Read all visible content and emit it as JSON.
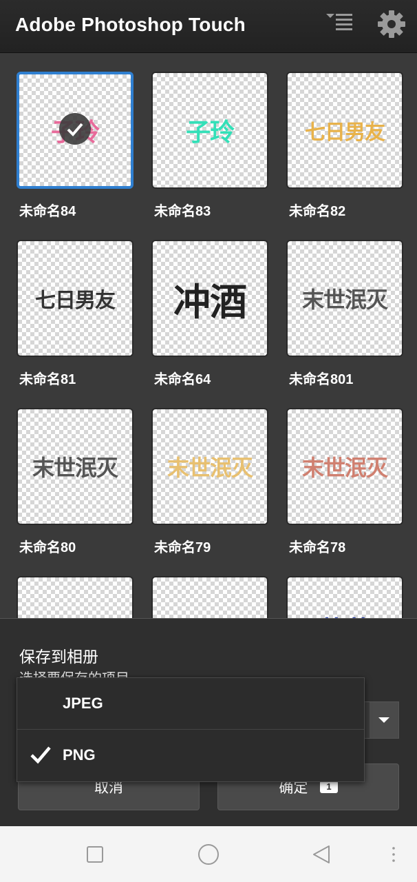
{
  "app": {
    "title": "Adobe Photoshop Touch"
  },
  "icons": {
    "sort": "sort-list-icon",
    "settings": "gear-icon",
    "check": "check-icon",
    "dropdown": "triangle-down-icon",
    "nav_recent": "square-icon",
    "nav_home": "circle-icon",
    "nav_back": "triangle-left-icon",
    "nav_more": "vertical-dots-icon"
  },
  "colors": {
    "selection": "#2f7fd0",
    "topbar": "#222222",
    "background": "#3a3a3a"
  },
  "projects": [
    {
      "name": "未命名84",
      "art_text": "子玲",
      "art_color": "#e86a9a",
      "selected": true
    },
    {
      "name": "未命名83",
      "art_text": "子玲",
      "art_color": "#33e0b8",
      "selected": false
    },
    {
      "name": "未命名82",
      "art_text": "七日男友",
      "art_color": "#e8b24a",
      "selected": false
    },
    {
      "name": "未命名81",
      "art_text": "七日男友",
      "art_color": "#333333",
      "selected": false
    },
    {
      "name": "未命名64",
      "art_text": "冲酒",
      "art_color": "#222222",
      "selected": false
    },
    {
      "name": "未命名801",
      "art_text": "末世泯灭",
      "art_color": "#555555",
      "selected": false
    },
    {
      "name": "未命名80",
      "art_text": "末世泯灭",
      "art_color": "#555555",
      "selected": false
    },
    {
      "name": "未命名79",
      "art_text": "末世泯灭",
      "art_color": "#e8c070",
      "selected": false
    },
    {
      "name": "未命名78",
      "art_text": "末世泯灭",
      "art_color": "#d08070",
      "selected": false
    },
    {
      "name": "",
      "art_text": "",
      "art_color": "#999999",
      "selected": false
    },
    {
      "name": "",
      "art_text": "",
      "art_color": "#c8a080",
      "selected": false
    },
    {
      "name": "",
      "art_text": "落花",
      "art_color": "#2a3fa0",
      "selected": false
    }
  ],
  "dialog": {
    "title": "保存到相册",
    "subtitle": "选择要保存的项目",
    "cancel_label": "取消",
    "ok_label": "确定",
    "selected_count": "1"
  },
  "format_menu": {
    "options": [
      {
        "label": "JPEG",
        "checked": false
      },
      {
        "label": "PNG",
        "checked": true
      }
    ]
  }
}
